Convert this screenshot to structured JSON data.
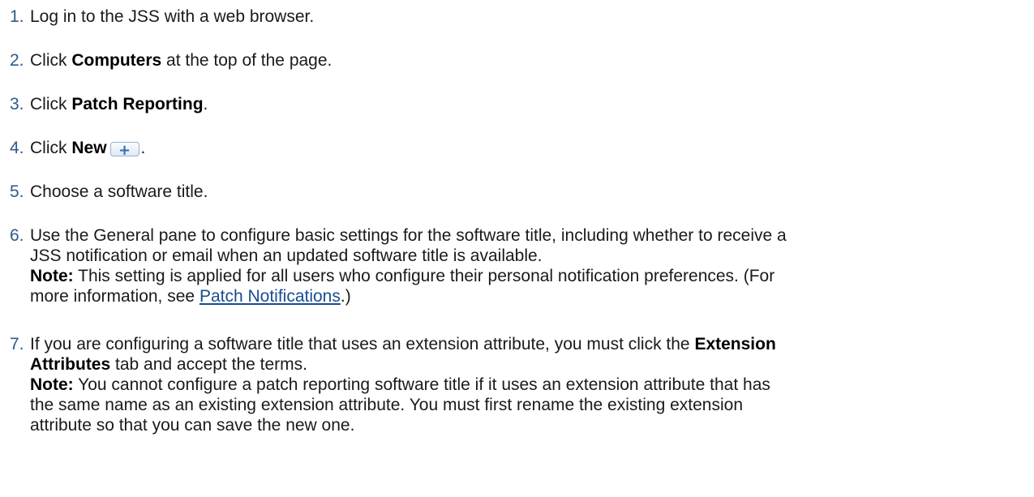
{
  "steps": [
    {
      "number": "1.",
      "text": "Log in to the JSS with a web browser."
    },
    {
      "number": "2.",
      "pre": "Click ",
      "bold": "Computers",
      "post": " at the top of the page."
    },
    {
      "number": "3.",
      "pre": "Click ",
      "bold": "Patch Reporting",
      "post": "."
    },
    {
      "number": "4.",
      "pre": "Click ",
      "bold": "New",
      "button_icon": "plus-icon",
      "button_glyph": "+",
      "post": "."
    },
    {
      "number": "5.",
      "text": "Choose a software title."
    },
    {
      "number": "6.",
      "line1": "Use the General pane to configure basic settings for the software title, including whether to receive a",
      "line2": "JSS notification or email when an updated software title is available.",
      "note_label": "Note:",
      "note_line1": " This setting is applied for all users who configure their personal notification preferences. (For",
      "note_line2_pre": "more information, see ",
      "note_link": "Patch Notifications",
      "note_line2_post": ".)"
    },
    {
      "number": "7.",
      "line1_pre": "If you are configuring a software title that uses an extension attribute, you must click the ",
      "line1_bold": "Extension",
      "line2_bold": "Attributes",
      "line2_post": " tab and accept the terms.",
      "note_label": "Note:",
      "note_line1": " You cannot configure a patch reporting software title if it uses an extension attribute that has",
      "note_line2": "the same name as an existing extension attribute. You must first rename the existing extension",
      "note_line3": "attribute so that you can save the new one."
    }
  ],
  "colors": {
    "number": "#2e5a8a",
    "link": "#1a4d8f",
    "text": "#1a1a1a"
  }
}
